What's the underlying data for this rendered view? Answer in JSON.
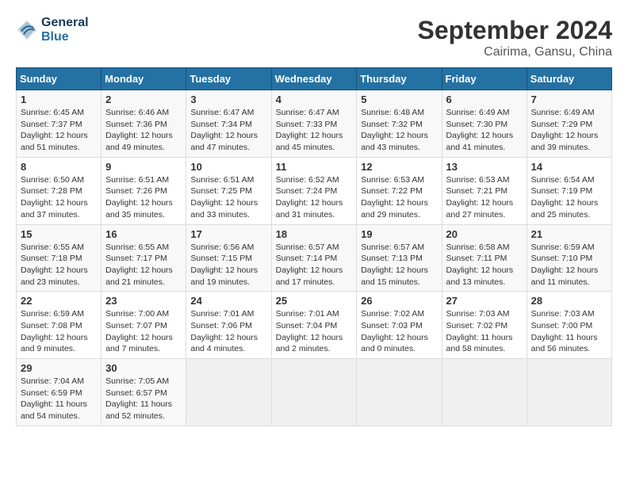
{
  "header": {
    "logo_line1": "General",
    "logo_line2": "Blue",
    "month": "September 2024",
    "location": "Cairima, Gansu, China"
  },
  "weekdays": [
    "Sunday",
    "Monday",
    "Tuesday",
    "Wednesday",
    "Thursday",
    "Friday",
    "Saturday"
  ],
  "weeks": [
    [
      {
        "day": "1",
        "sunrise": "6:45 AM",
        "sunset": "7:37 PM",
        "daylight": "12 hours and 51 minutes."
      },
      {
        "day": "2",
        "sunrise": "6:46 AM",
        "sunset": "7:36 PM",
        "daylight": "12 hours and 49 minutes."
      },
      {
        "day": "3",
        "sunrise": "6:47 AM",
        "sunset": "7:34 PM",
        "daylight": "12 hours and 47 minutes."
      },
      {
        "day": "4",
        "sunrise": "6:47 AM",
        "sunset": "7:33 PM",
        "daylight": "12 hours and 45 minutes."
      },
      {
        "day": "5",
        "sunrise": "6:48 AM",
        "sunset": "7:32 PM",
        "daylight": "12 hours and 43 minutes."
      },
      {
        "day": "6",
        "sunrise": "6:49 AM",
        "sunset": "7:30 PM",
        "daylight": "12 hours and 41 minutes."
      },
      {
        "day": "7",
        "sunrise": "6:49 AM",
        "sunset": "7:29 PM",
        "daylight": "12 hours and 39 minutes."
      }
    ],
    [
      {
        "day": "8",
        "sunrise": "6:50 AM",
        "sunset": "7:28 PM",
        "daylight": "12 hours and 37 minutes."
      },
      {
        "day": "9",
        "sunrise": "6:51 AM",
        "sunset": "7:26 PM",
        "daylight": "12 hours and 35 minutes."
      },
      {
        "day": "10",
        "sunrise": "6:51 AM",
        "sunset": "7:25 PM",
        "daylight": "12 hours and 33 minutes."
      },
      {
        "day": "11",
        "sunrise": "6:52 AM",
        "sunset": "7:24 PM",
        "daylight": "12 hours and 31 minutes."
      },
      {
        "day": "12",
        "sunrise": "6:53 AM",
        "sunset": "7:22 PM",
        "daylight": "12 hours and 29 minutes."
      },
      {
        "day": "13",
        "sunrise": "6:53 AM",
        "sunset": "7:21 PM",
        "daylight": "12 hours and 27 minutes."
      },
      {
        "day": "14",
        "sunrise": "6:54 AM",
        "sunset": "7:19 PM",
        "daylight": "12 hours and 25 minutes."
      }
    ],
    [
      {
        "day": "15",
        "sunrise": "6:55 AM",
        "sunset": "7:18 PM",
        "daylight": "12 hours and 23 minutes."
      },
      {
        "day": "16",
        "sunrise": "6:55 AM",
        "sunset": "7:17 PM",
        "daylight": "12 hours and 21 minutes."
      },
      {
        "day": "17",
        "sunrise": "6:56 AM",
        "sunset": "7:15 PM",
        "daylight": "12 hours and 19 minutes."
      },
      {
        "day": "18",
        "sunrise": "6:57 AM",
        "sunset": "7:14 PM",
        "daylight": "12 hours and 17 minutes."
      },
      {
        "day": "19",
        "sunrise": "6:57 AM",
        "sunset": "7:13 PM",
        "daylight": "12 hours and 15 minutes."
      },
      {
        "day": "20",
        "sunrise": "6:58 AM",
        "sunset": "7:11 PM",
        "daylight": "12 hours and 13 minutes."
      },
      {
        "day": "21",
        "sunrise": "6:59 AM",
        "sunset": "7:10 PM",
        "daylight": "12 hours and 11 minutes."
      }
    ],
    [
      {
        "day": "22",
        "sunrise": "6:59 AM",
        "sunset": "7:08 PM",
        "daylight": "12 hours and 9 minutes."
      },
      {
        "day": "23",
        "sunrise": "7:00 AM",
        "sunset": "7:07 PM",
        "daylight": "12 hours and 7 minutes."
      },
      {
        "day": "24",
        "sunrise": "7:01 AM",
        "sunset": "7:06 PM",
        "daylight": "12 hours and 4 minutes."
      },
      {
        "day": "25",
        "sunrise": "7:01 AM",
        "sunset": "7:04 PM",
        "daylight": "12 hours and 2 minutes."
      },
      {
        "day": "26",
        "sunrise": "7:02 AM",
        "sunset": "7:03 PM",
        "daylight": "12 hours and 0 minutes."
      },
      {
        "day": "27",
        "sunrise": "7:03 AM",
        "sunset": "7:02 PM",
        "daylight": "11 hours and 58 minutes."
      },
      {
        "day": "28",
        "sunrise": "7:03 AM",
        "sunset": "7:00 PM",
        "daylight": "11 hours and 56 minutes."
      }
    ],
    [
      {
        "day": "29",
        "sunrise": "7:04 AM",
        "sunset": "6:59 PM",
        "daylight": "11 hours and 54 minutes."
      },
      {
        "day": "30",
        "sunrise": "7:05 AM",
        "sunset": "6:57 PM",
        "daylight": "11 hours and 52 minutes."
      },
      null,
      null,
      null,
      null,
      null
    ]
  ]
}
